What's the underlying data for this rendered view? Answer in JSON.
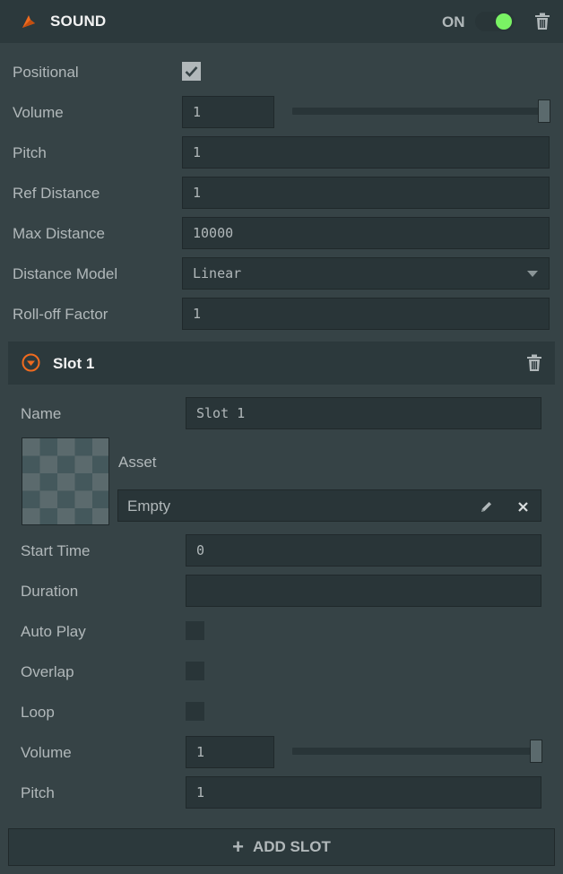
{
  "header": {
    "title": "SOUND",
    "toggle_label": "ON",
    "enabled": true
  },
  "component": {
    "positional": {
      "label": "Positional",
      "checked": true
    },
    "volume": {
      "label": "Volume",
      "value": "1",
      "slider_fraction": 1.0
    },
    "pitch": {
      "label": "Pitch",
      "value": "1"
    },
    "ref_distance": {
      "label": "Ref Distance",
      "value": "1"
    },
    "max_distance": {
      "label": "Max Distance",
      "value": "10000"
    },
    "distance_model": {
      "label": "Distance Model",
      "value": "Linear"
    },
    "rolloff_factor": {
      "label": "Roll-off Factor",
      "value": "1"
    }
  },
  "slot": {
    "title": "Slot 1",
    "name": {
      "label": "Name",
      "value": "Slot 1"
    },
    "asset": {
      "label": "Asset",
      "value": "Empty"
    },
    "start_time": {
      "label": "Start Time",
      "value": "0"
    },
    "duration": {
      "label": "Duration",
      "value": ""
    },
    "auto_play": {
      "label": "Auto Play",
      "checked": false
    },
    "overlap": {
      "label": "Overlap",
      "checked": false
    },
    "loop": {
      "label": "Loop",
      "checked": false
    },
    "volume": {
      "label": "Volume",
      "value": "1",
      "slider_fraction": 1.0
    },
    "pitch": {
      "label": "Pitch",
      "value": "1"
    }
  },
  "add_slot": {
    "icon": "+",
    "label": "ADD SLOT"
  },
  "colors": {
    "accent_orange": "#f06b1f",
    "toggle_on": "#7af364",
    "panel_bg": "#364346",
    "header_bg": "#2c393c"
  }
}
